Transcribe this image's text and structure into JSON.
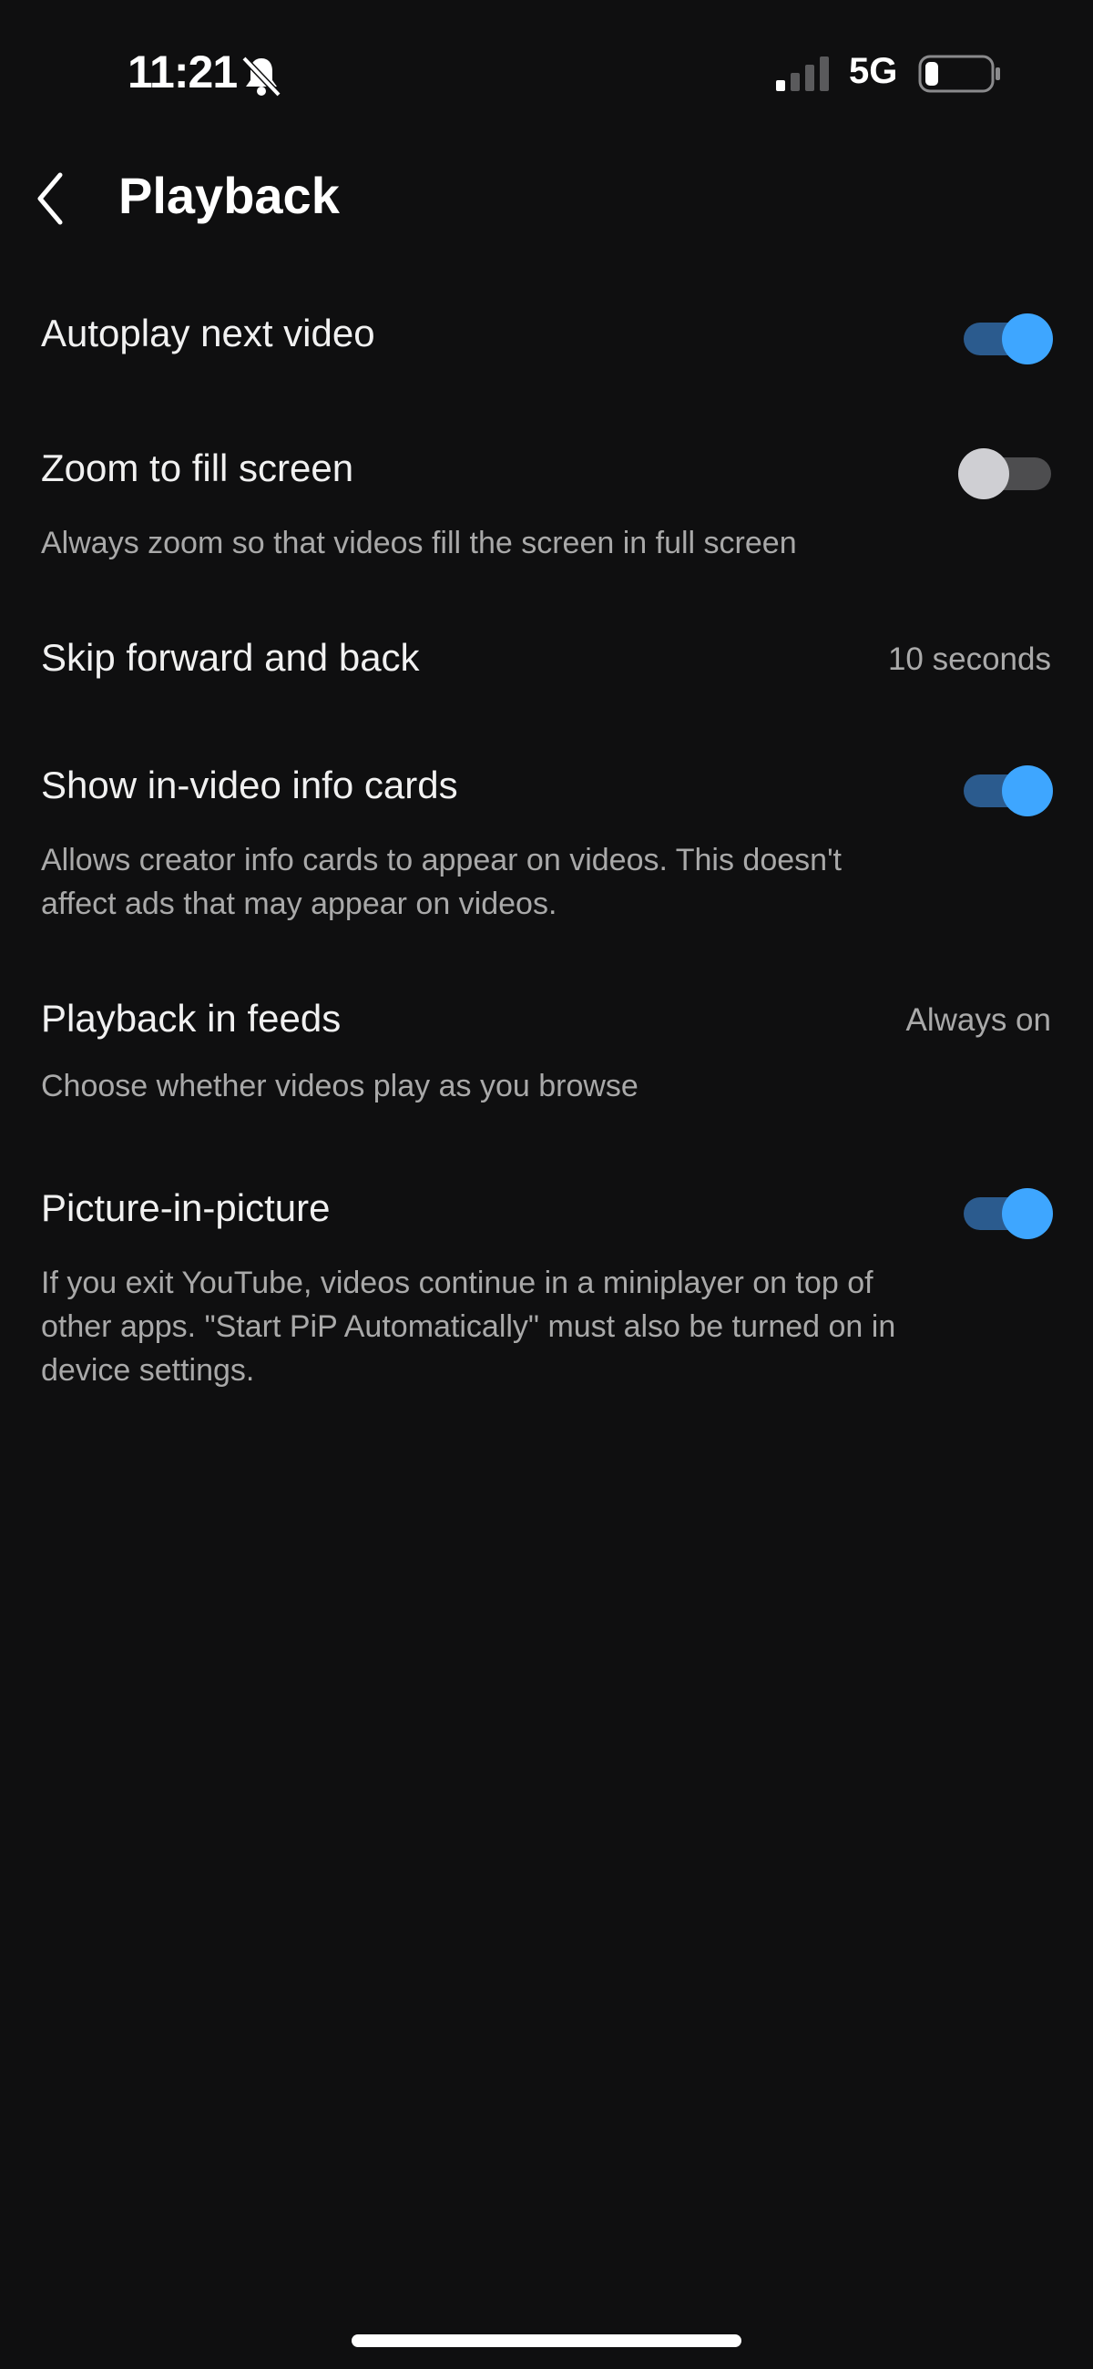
{
  "status_bar": {
    "time": "11:21",
    "network": "5G"
  },
  "header": {
    "title": "Playback"
  },
  "settings": [
    {
      "title": "Autoplay next video",
      "toggle": true
    },
    {
      "title": "Zoom to fill screen",
      "description": "Always zoom so that videos fill the screen in full screen",
      "toggle": false
    },
    {
      "title": "Skip forward and back",
      "value": "10 seconds"
    },
    {
      "title": "Show in-video info cards",
      "description": "Allows creator info cards to appear on videos. This doesn't affect ads that may appear on videos.",
      "toggle": true
    },
    {
      "title": "Playback in feeds",
      "description": "Choose whether videos play as you browse",
      "value": "Always on"
    },
    {
      "title": "Picture-in-picture",
      "description": "If you exit YouTube, videos continue in a miniplayer on top of other apps. \"Start PiP Automatically\" must also be turned on in device settings.",
      "toggle": true
    }
  ],
  "colors": {
    "background": "#0f0f10",
    "toggle_on_track": "#2b5b8e",
    "toggle_on_knob": "#3ea6ff",
    "toggle_off_track": "#4d4d4f",
    "toggle_off_knob": "#cfcfd3"
  },
  "icons": [
    "muted-bell-icon",
    "cellular-signal-icon",
    "battery-icon",
    "back-chevron-icon"
  ]
}
